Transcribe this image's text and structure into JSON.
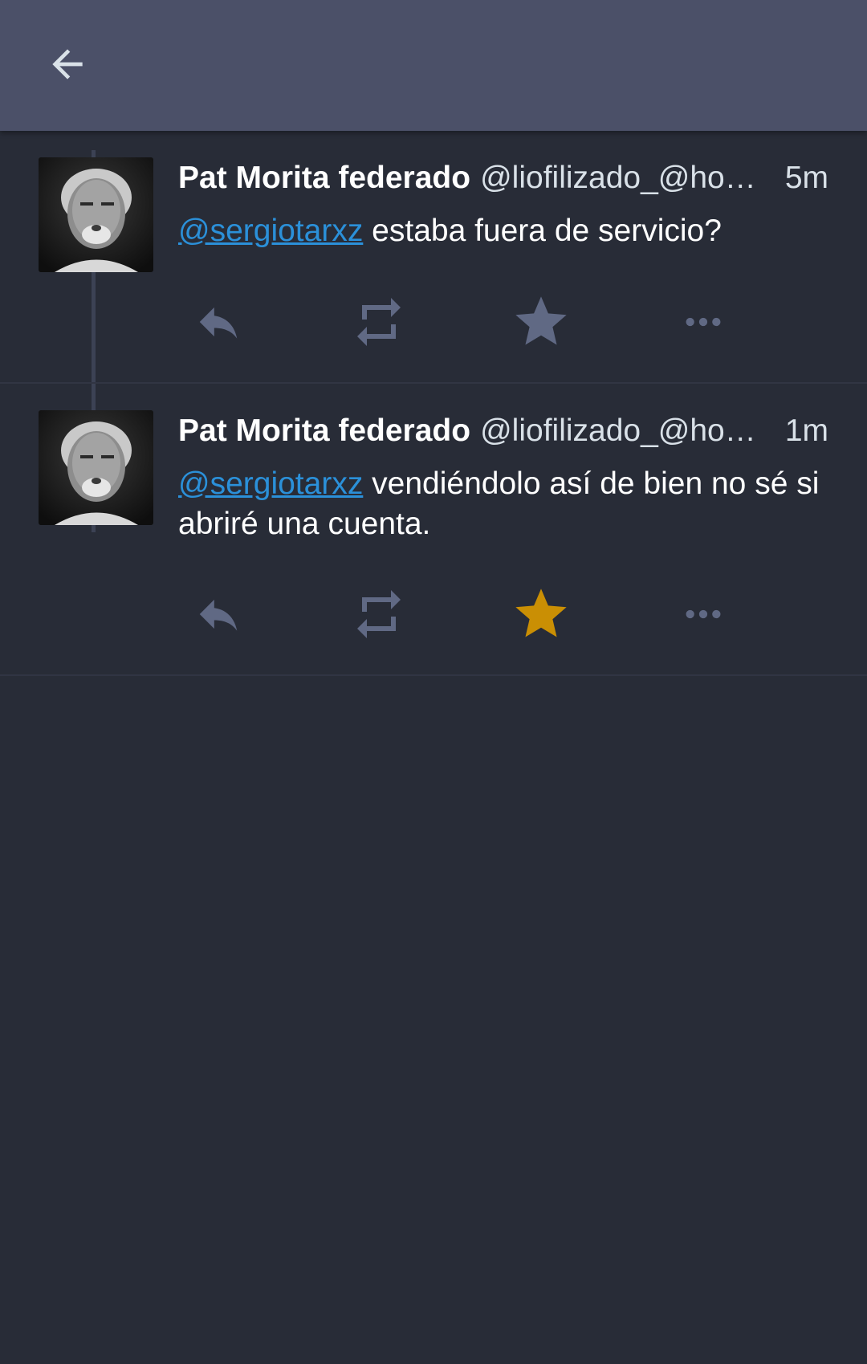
{
  "appbar": {
    "back_icon": "arrow-left-icon"
  },
  "colors": {
    "background": "#282c37",
    "appbar": "#4b5068",
    "icon": "#606984",
    "favourited": "#ca8f04",
    "mention": "#2b90d9"
  },
  "statuses": [
    {
      "display_name": "Pat Morita federado",
      "acct": "@liofilizado_@ho…",
      "time": "5m",
      "mention": "@sergiotarxz",
      "text": " estaba fuera de servicio?",
      "favourited": false,
      "actions": [
        "reply-icon",
        "boost-icon",
        "star-icon",
        "more-icon"
      ]
    },
    {
      "display_name": "Pat Morita federado",
      "acct": "@liofilizado_@ho…",
      "time": "1m",
      "mention": "@sergiotarxz",
      "text": " vendiéndolo así de bien no sé si abriré una cuenta.",
      "favourited": true,
      "actions": [
        "reply-icon",
        "boost-icon",
        "star-icon",
        "more-icon"
      ]
    }
  ]
}
